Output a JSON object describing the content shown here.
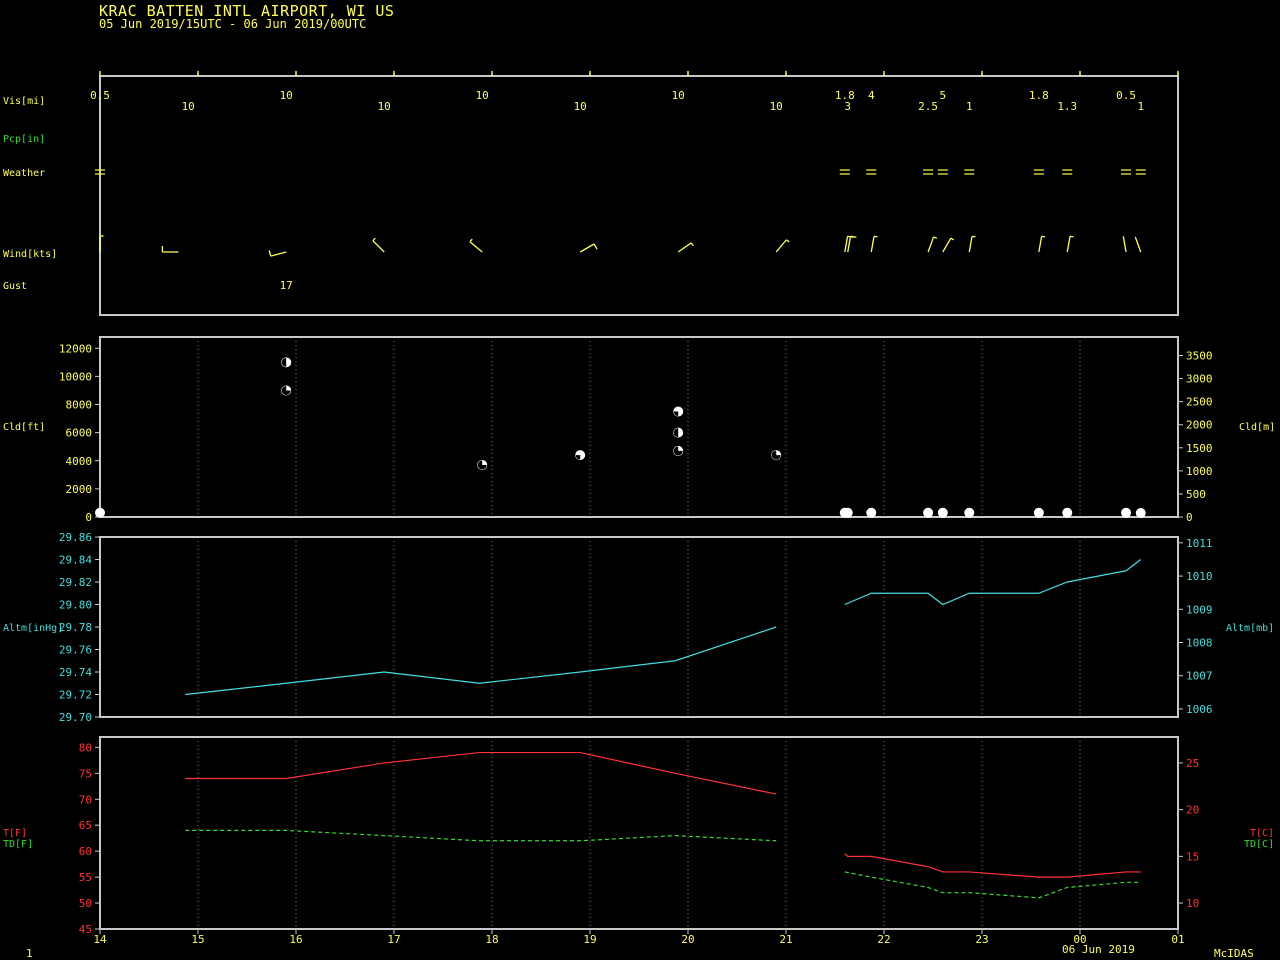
{
  "header": {
    "station": "KRAC  BATTEN INTL AIRPORT, WI US",
    "period": "05 Jun 2019/15UTC - 06 Jun 2019/00UTC"
  },
  "footer": {
    "left": "1",
    "date": "06 Jun 2019",
    "brand": "McIDAS"
  },
  "colors": {
    "text": "#ffff55",
    "temp": "#ff3333",
    "dew": "#33dd33",
    "altm": "#44dddd",
    "frame": "#c8c8c8",
    "grid": "#777777"
  },
  "x_ticks": [
    "14",
    "15",
    "16",
    "17",
    "18",
    "19",
    "20",
    "21",
    "22",
    "23",
    "00",
    "01"
  ],
  "chart_data": [
    {
      "type": "table",
      "panel": "surface observations",
      "labels": {
        "vis": "Vis[mi]",
        "pcp": "Pcp[in]",
        "weather": "Weather",
        "wind": "Wind[kts]",
        "gust": "Gust"
      },
      "x_range_hours": [
        14,
        25
      ],
      "vis": [
        {
          "t": 14.0,
          "text": "0.5",
          "row": 0
        },
        {
          "t": 14.9,
          "text": "10",
          "row": 1
        },
        {
          "t": 15.9,
          "text": "10",
          "row": 0
        },
        {
          "t": 16.9,
          "text": "10",
          "row": 1
        },
        {
          "t": 17.9,
          "text": "10",
          "row": 0
        },
        {
          "t": 18.9,
          "text": "10",
          "row": 1
        },
        {
          "t": 19.9,
          "text": "10",
          "row": 0
        },
        {
          "t": 20.9,
          "text": "10",
          "row": 1
        },
        {
          "t": 21.6,
          "text": "1.8",
          "row": 0
        },
        {
          "t": 21.63,
          "text": "3",
          "row": 1
        },
        {
          "t": 21.87,
          "text": "4",
          "row": 0
        },
        {
          "t": 22.45,
          "text": "2.5",
          "row": 1
        },
        {
          "t": 22.6,
          "text": "5",
          "row": 0
        },
        {
          "t": 22.87,
          "text": "1",
          "row": 1
        },
        {
          "t": 23.58,
          "text": "1.8",
          "row": 0
        },
        {
          "t": 23.87,
          "text": "1.3",
          "row": 1
        },
        {
          "t": 24.47,
          "text": "0.5",
          "row": 0
        },
        {
          "t": 24.62,
          "text": "1",
          "row": 1
        }
      ],
      "weather": [
        {
          "t": 14.0,
          "sym": "fog"
        },
        {
          "t": 21.6,
          "sym": "fog"
        },
        {
          "t": 21.87,
          "sym": "fog"
        },
        {
          "t": 22.45,
          "sym": "fog"
        },
        {
          "t": 22.6,
          "sym": "fog"
        },
        {
          "t": 22.87,
          "sym": "fog"
        },
        {
          "t": 23.58,
          "sym": "fog"
        },
        {
          "t": 23.87,
          "sym": "fog"
        },
        {
          "t": 24.47,
          "sym": "fog"
        },
        {
          "t": 24.62,
          "sym": "fog"
        }
      ],
      "wind": [
        {
          "t": 14.0,
          "dir": 0,
          "spd": 5
        },
        {
          "t": 14.8,
          "dir": 270,
          "spd": 8
        },
        {
          "t": 15.9,
          "dir": 255,
          "spd": 10
        },
        {
          "t": 16.9,
          "dir": 315,
          "spd": 5
        },
        {
          "t": 17.9,
          "dir": 310,
          "spd": 5
        },
        {
          "t": 18.9,
          "dir": 60,
          "spd": 8
        },
        {
          "t": 19.9,
          "dir": 55,
          "spd": 5
        },
        {
          "t": 20.9,
          "dir": 40,
          "spd": 5
        },
        {
          "t": 21.6,
          "dir": 10,
          "spd": 10
        },
        {
          "t": 21.63,
          "dir": 10,
          "spd": 10
        },
        {
          "t": 21.87,
          "dir": 10,
          "spd": 5
        },
        {
          "t": 22.45,
          "dir": 20,
          "spd": 5
        },
        {
          "t": 22.6,
          "dir": 30,
          "spd": 5
        },
        {
          "t": 22.87,
          "dir": 10,
          "spd": 5
        },
        {
          "t": 23.58,
          "dir": 10,
          "spd": 5
        },
        {
          "t": 23.87,
          "dir": 10,
          "spd": 5
        },
        {
          "t": 24.47,
          "dir": 350,
          "spd": 0
        },
        {
          "t": 24.62,
          "dir": 340,
          "spd": 0
        }
      ],
      "gust": [
        {
          "t": 15.9,
          "text": "17"
        }
      ]
    },
    {
      "type": "scatter",
      "panel": "cloud",
      "ylabel_left": "Cld[ft]",
      "ylabel_right": "Cld[m]",
      "ylim_ft": [
        0,
        12800
      ],
      "yticks_ft": [
        "0",
        "2000",
        "4000",
        "6000",
        "8000",
        "10000",
        "12000"
      ],
      "yticks_m": [
        "0",
        "500",
        "1000",
        "1500",
        "2000",
        "2500",
        "3000",
        "3500"
      ],
      "points": [
        {
          "t": 14.0,
          "ft": 300,
          "cover": "ovc"
        },
        {
          "t": 15.9,
          "ft": 11000,
          "cover": "bkn"
        },
        {
          "t": 15.9,
          "ft": 9000,
          "cover": "sct"
        },
        {
          "t": 17.9,
          "ft": 3700,
          "cover": "sct"
        },
        {
          "t": 18.9,
          "ft": 4400,
          "cover": "bkn2"
        },
        {
          "t": 19.9,
          "ft": 7500,
          "cover": "bkn2"
        },
        {
          "t": 19.9,
          "ft": 6000,
          "cover": "bkn"
        },
        {
          "t": 19.9,
          "ft": 4700,
          "cover": "sct"
        },
        {
          "t": 20.9,
          "ft": 4400,
          "cover": "sct"
        },
        {
          "t": 21.6,
          "ft": 300,
          "cover": "ovc"
        },
        {
          "t": 21.63,
          "ft": 300,
          "cover": "ovc"
        },
        {
          "t": 21.87,
          "ft": 300,
          "cover": "ovc"
        },
        {
          "t": 22.45,
          "ft": 300,
          "cover": "ovc"
        },
        {
          "t": 22.6,
          "ft": 300,
          "cover": "ovc"
        },
        {
          "t": 22.87,
          "ft": 300,
          "cover": "ovc"
        },
        {
          "t": 23.58,
          "ft": 300,
          "cover": "ovc"
        },
        {
          "t": 23.87,
          "ft": 300,
          "cover": "ovc"
        },
        {
          "t": 24.47,
          "ft": 300,
          "cover": "ovc"
        },
        {
          "t": 24.62,
          "ft": 100,
          "cover": "ovc"
        }
      ]
    },
    {
      "type": "line",
      "panel": "altimeter",
      "ylabel_left": "Altm[inHg]",
      "ylabel_right": "Altm[mb]",
      "ylim": [
        29.7,
        29.86
      ],
      "yticks_left": [
        "29.70",
        "29.72",
        "29.74",
        "29.76",
        "29.78",
        "29.80",
        "29.82",
        "29.84",
        "29.86"
      ],
      "yticks_right": [
        "1006",
        "1007",
        "1008",
        "1009",
        "1010",
        "1011"
      ],
      "series": [
        {
          "x": [
            14.87,
            15.9,
            16.9,
            17.87,
            18.9,
            19.87,
            20.9
          ],
          "y": [
            29.72,
            29.73,
            29.74,
            29.73,
            29.74,
            29.75,
            29.78
          ]
        },
        {
          "x": [
            21.6,
            21.87,
            22.45,
            22.6,
            22.87,
            23.58,
            23.87,
            24.47,
            24.62
          ],
          "y": [
            29.8,
            29.81,
            29.81,
            29.8,
            29.81,
            29.81,
            29.82,
            29.83,
            29.84
          ]
        }
      ]
    },
    {
      "type": "line",
      "panel": "temperature",
      "ylabel_left_t": "T[F]",
      "ylabel_left_td": "TD[F]",
      "ylabel_right_t": "T[C]",
      "ylabel_right_td": "TD[C]",
      "ylim": [
        45,
        82
      ],
      "yticks_left": [
        "45",
        "50",
        "55",
        "60",
        "65",
        "70",
        "75",
        "80"
      ],
      "yticks_right": [
        "10",
        "15",
        "20",
        "25"
      ],
      "series": [
        {
          "name": "T[F]",
          "style": "solid",
          "segments": [
            {
              "x": [
                14.87,
                15.9,
                16.9,
                17.87,
                18.9,
                19.87,
                20.9
              ],
              "y": [
                74,
                74,
                77,
                79,
                79,
                75,
                71
              ]
            },
            {
              "x": [
                21.6,
                21.63,
                21.87,
                22.45,
                22.6,
                22.87,
                23.58,
                23.87,
                24.47,
                24.62
              ],
              "y": [
                59.5,
                59,
                59,
                57,
                56,
                56,
                55,
                55,
                56,
                56
              ]
            }
          ]
        },
        {
          "name": "TD[F]",
          "style": "dashed",
          "segments": [
            {
              "x": [
                14.87,
                15.9,
                16.9,
                17.87,
                18.9,
                19.87,
                20.9
              ],
              "y": [
                64,
                64,
                63,
                62,
                62,
                63,
                62
              ]
            },
            {
              "x": [
                21.6,
                21.87,
                22.45,
                22.6,
                22.87,
                23.58,
                23.87,
                24.47,
                24.62
              ],
              "y": [
                56,
                55,
                53,
                52,
                52,
                51,
                53,
                54,
                54
              ]
            }
          ]
        }
      ]
    }
  ]
}
